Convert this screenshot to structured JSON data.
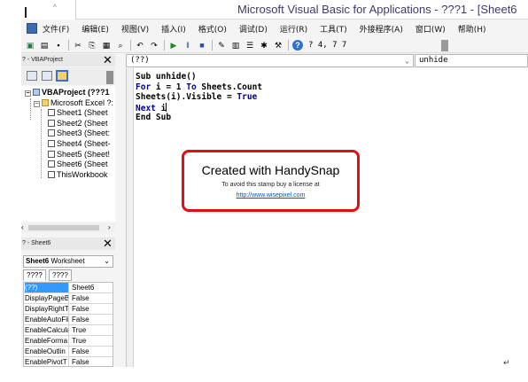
{
  "window": {
    "title": "Microsoft Visual Basic for Applications - ???1 - [Sheet6"
  },
  "menu": {
    "items": [
      {
        "label": "文件(F)"
      },
      {
        "label": "编辑(E)"
      },
      {
        "label": "视图(V)"
      },
      {
        "label": "插入(I)"
      },
      {
        "label": "格式(O)"
      },
      {
        "label": "调试(D)"
      },
      {
        "label": "运行(R)"
      },
      {
        "label": "工具(T)"
      },
      {
        "label": "外接程序(A)"
      },
      {
        "label": "窗口(W)"
      },
      {
        "label": "帮助(H)"
      }
    ]
  },
  "toolbar": {
    "cursor_position": "? 4, 7 7",
    "buttons": [
      {
        "icon": "excel-view-icon",
        "glyph": "▣"
      },
      {
        "icon": "insert-module-icon",
        "glyph": "▤"
      },
      {
        "icon": "save-icon",
        "glyph": "▪"
      },
      {
        "icon": "cut-icon",
        "glyph": "✂"
      },
      {
        "icon": "copy-icon",
        "glyph": "⎘"
      },
      {
        "icon": "paste-icon",
        "glyph": "▦"
      },
      {
        "icon": "find-icon",
        "glyph": "⌕"
      },
      {
        "icon": "undo-icon",
        "glyph": "↶"
      },
      {
        "icon": "redo-icon",
        "glyph": "↷"
      },
      {
        "icon": "run-icon",
        "glyph": "▶"
      },
      {
        "icon": "break-icon",
        "glyph": "‖"
      },
      {
        "icon": "reset-icon",
        "glyph": "■"
      },
      {
        "icon": "design-mode-icon",
        "glyph": "✎"
      },
      {
        "icon": "project-explorer-icon",
        "glyph": "▥"
      },
      {
        "icon": "properties-icon",
        "glyph": "☰"
      },
      {
        "icon": "object-browser-icon",
        "glyph": "✱"
      },
      {
        "icon": "toolbox-icon",
        "glyph": "⚒"
      },
      {
        "icon": "help-icon",
        "glyph": "?"
      }
    ]
  },
  "project_pane": {
    "title": "? - VBAProject",
    "tree": [
      {
        "label": "VBAProject (???1",
        "level": 0,
        "bold": true,
        "icon": "project-icon"
      },
      {
        "label": "Microsoft Excel ?:",
        "level": 1,
        "bold": false,
        "icon": "folder-icon"
      },
      {
        "label": "Sheet1 (Sheet",
        "level": 2,
        "bold": false,
        "icon": "sheet-icon"
      },
      {
        "label": "Sheet2 (Sheet",
        "level": 2,
        "bold": false,
        "icon": "sheet-icon"
      },
      {
        "label": "Sheet3 (Sheet:",
        "level": 2,
        "bold": false,
        "icon": "sheet-icon"
      },
      {
        "label": "Sheet4 (Sheet-",
        "level": 2,
        "bold": false,
        "icon": "sheet-icon"
      },
      {
        "label": "Sheet5 (Sheet!",
        "level": 2,
        "bold": false,
        "icon": "sheet-icon"
      },
      {
        "label": "Sheet6 (Sheet",
        "level": 2,
        "bold": false,
        "icon": "sheet-icon"
      },
      {
        "label": "ThisWorkbook",
        "level": 2,
        "bold": false,
        "icon": "workbook-icon"
      }
    ]
  },
  "properties_pane": {
    "title": "? - Sheet6",
    "object_name": "Sheet6",
    "object_type": "Worksheet",
    "tabs": [
      "????",
      "????"
    ],
    "rows": [
      {
        "name": "(??)",
        "value": "Sheet6",
        "selected": true
      },
      {
        "name": "DisplayPageB",
        "value": "False",
        "selected": false
      },
      {
        "name": "DisplayRightT",
        "value": "False",
        "selected": false
      },
      {
        "name": "EnableAutoFil",
        "value": "False",
        "selected": false
      },
      {
        "name": "EnableCalcula",
        "value": "True",
        "selected": false
      },
      {
        "name": "EnableForma",
        "value": "True",
        "selected": false
      },
      {
        "name": "EnableOutlin",
        "value": "False",
        "selected": false
      },
      {
        "name": "EnablePivotT",
        "value": "False",
        "selected": false
      }
    ]
  },
  "code_window": {
    "object_dropdown": "(??)",
    "procedure_dropdown": "unhide",
    "lines": [
      {
        "segments": [
          {
            "text": "Sub unhide()",
            "kw": false
          }
        ]
      },
      {
        "segments": [
          {
            "text": "For",
            "kw": true
          },
          {
            "text": " i = 1 ",
            "kw": false
          },
          {
            "text": "To",
            "kw": true
          },
          {
            "text": " Sheets.Count",
            "kw": false
          }
        ]
      },
      {
        "segments": [
          {
            "text": "Sheets(i).Visible = ",
            "kw": false
          },
          {
            "text": "True",
            "kw": true
          }
        ]
      },
      {
        "segments": [
          {
            "text": "Next",
            "kw": true
          },
          {
            "text": " i",
            "kw": false
          }
        ],
        "caret": true
      },
      {
        "segments": [
          {
            "text": "End Sub",
            "kw": false
          }
        ]
      }
    ]
  },
  "stamp": {
    "title": "Created with HandySnap",
    "subtitle": "To avoid this stamp buy a license at",
    "link": "http://www.wisepixel.com"
  },
  "page": {
    "return_mark": "↵"
  }
}
